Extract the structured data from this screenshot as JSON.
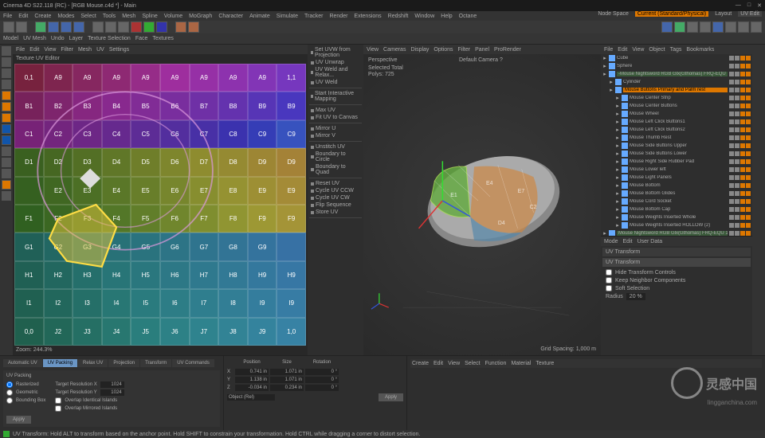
{
  "window": {
    "title": "Cinema 4D S22.118 (RC) - [RGB Mouse.c4d *] - Main",
    "close": "✕",
    "max": "□",
    "min": "—"
  },
  "menu": [
    "File",
    "Edit",
    "Create",
    "Modes",
    "Select",
    "Tools",
    "Mesh",
    "Spline",
    "Volume",
    "MoGraph",
    "Character",
    "Animate",
    "Simulate",
    "Tracker",
    "Render",
    "Extensions",
    "Redshift",
    "Window",
    "Help",
    "Octane"
  ],
  "toolbar2": {
    "modes": [
      "Model",
      "UV Mesh",
      "Undo",
      "Layer",
      "Texture Selection",
      "Face",
      "Textures"
    ]
  },
  "topright": {
    "space": "Node Space",
    "current": "Current (Standard/Physical)",
    "layout": "Layout",
    "uv": "UV Edit"
  },
  "uv": {
    "menu": [
      "File",
      "Edit",
      "View",
      "Filter",
      "Mesh",
      "UV",
      "Settings"
    ],
    "title": "Texture UV Editor",
    "zoom": "Zoom: 244.3%",
    "labels": [
      [
        "0,1",
        "A9",
        "A9",
        "A9",
        "A9",
        "A9",
        "A9",
        "A9",
        "A9",
        "1,1"
      ],
      [
        "B1",
        "B2",
        "B3",
        "B4",
        "B5",
        "B6",
        "B7",
        "B8",
        "B9",
        "B9"
      ],
      [
        "C1",
        "C2",
        "C3",
        "C4",
        "C5",
        "C6",
        "C7",
        "C8",
        "C9",
        "C9"
      ],
      [
        "D1",
        "D2",
        "D3",
        "D4",
        "D5",
        "D6",
        "D7",
        "D8",
        "D9",
        "D9"
      ],
      [
        "",
        "E2",
        "E3",
        "E4",
        "E5",
        "E6",
        "E7",
        "E8",
        "E9",
        "E9"
      ],
      [
        "F1",
        "F2",
        "F3",
        "F4",
        "F5",
        "F6",
        "F7",
        "F8",
        "F9",
        "F9"
      ],
      [
        "G1",
        "G2",
        "G3",
        "G4",
        "G5",
        "G6",
        "G7",
        "G8",
        "G9",
        ""
      ],
      [
        "H1",
        "H2",
        "H3",
        "H4",
        "H5",
        "H6",
        "H7",
        "H8",
        "H9",
        "H9"
      ],
      [
        "I1",
        "I2",
        "I3",
        "I4",
        "I5",
        "I6",
        "I7",
        "I8",
        "I9",
        "I9"
      ],
      [
        "0,0",
        "J2",
        "J3",
        "J4",
        "J5",
        "J6",
        "J7",
        "J8",
        "J9",
        "1,0"
      ]
    ]
  },
  "uvtools": {
    "sections": [
      {
        "title": "",
        "items": [
          "Set UVW from Projection",
          "UV Unwrap",
          "UV Weld and Relax...",
          "UV Weld"
        ]
      },
      {
        "title": "",
        "items": [
          "Start Interactive Mapping"
        ]
      },
      {
        "title": "",
        "items": [
          "Max UV",
          "Fit UV to Canvas"
        ]
      },
      {
        "title": "",
        "items": [
          "Mirror U",
          "Mirror V"
        ]
      },
      {
        "title": "",
        "items": [
          "Unstitch UV",
          "Boundary to Circle",
          "Boundary to Quad"
        ]
      },
      {
        "title": "",
        "items": [
          "Reset UV",
          "Cycle UV CCW",
          "Cycle UV CW",
          "Flip Sequence",
          "Store UV"
        ]
      }
    ]
  },
  "viewport": {
    "menu": [
      "View",
      "Cameras",
      "Display",
      "Options",
      "Filter",
      "Panel",
      "ProRender"
    ],
    "persp": "Perspective",
    "cam": "Default Camera ?",
    "total": "Selected Total",
    "polys": "Polys: 725",
    "grid": "Grid Spacing: 1,000 m"
  },
  "objects": {
    "menu": [
      "File",
      "Edit",
      "View",
      "Object",
      "Tags",
      "Bookmarks"
    ],
    "items": [
      {
        "n": "Cube",
        "d": 0
      },
      {
        "n": "Sphere",
        "d": 0
      },
      {
        "n": "-Mouse Nightsword RGB Glx(Gthomas) FRQ-EQU",
        "d": 0,
        "hl": true
      },
      {
        "n": "Cylinder",
        "d": 1
      },
      {
        "n": "Mouse Buttons Primary and Palm rest",
        "d": 1,
        "sel": true
      },
      {
        "n": "Mouse Center Strip",
        "d": 2
      },
      {
        "n": "Mouse Center Buttons",
        "d": 2
      },
      {
        "n": "Mouse Wheel",
        "d": 2
      },
      {
        "n": "Mouse Left Click Buttons1",
        "d": 2
      },
      {
        "n": "Mouse Left Click Buttons2",
        "d": 2
      },
      {
        "n": "Mouse Thumb Rest",
        "d": 2
      },
      {
        "n": "Mouse Side Buttons Upper",
        "d": 2
      },
      {
        "n": "Mouse Side Buttons Lower",
        "d": 2
      },
      {
        "n": "Mouse Right Side Rubber Pad",
        "d": 2
      },
      {
        "n": "Mouse Lower left",
        "d": 2
      },
      {
        "n": "Mouse Light Panels",
        "d": 2
      },
      {
        "n": "Mouse Bottom",
        "d": 2
      },
      {
        "n": "Mouse Bottom Glides",
        "d": 2
      },
      {
        "n": "Mouse Cord Socket",
        "d": 2
      },
      {
        "n": "Mouse Bottom Cap",
        "d": 2
      },
      {
        "n": "Mouse Weights Inserted Whole",
        "d": 2
      },
      {
        "n": "Mouse Weights Inserted HOLLOW (2)",
        "d": 2
      },
      {
        "n": "Mouse Nightsword RGB Glx(Gthomas) FRQ-EQU 1",
        "d": 0,
        "hl": true
      }
    ]
  },
  "attr": {
    "menu": [
      "Mode",
      "Edit",
      "User Data"
    ],
    "title": "UV Transform",
    "t2": "UV Transform",
    "chk1": "Hide Transform Controls",
    "chk2": "Keep Neighbor Components",
    "chk3": "Soft Selection",
    "radius": "Radius",
    "rval": "20 %"
  },
  "bottom": {
    "tabs": [
      "Automatic UV",
      "UV Packing",
      "Relax UV",
      "Projection",
      "Transform",
      "UV Commands"
    ],
    "pack": {
      "title": "UV Packing",
      "rast": "Rasterized",
      "geo": "Geometric",
      "bb": "Bounding Box",
      "trx": "Target Resolution X",
      "trxv": "1024",
      "try": "Target Resolution Y",
      "tryv": "1024",
      "ovi": "Overlap Identical Islands",
      "ovm": "Overlap Mirrored Islands",
      "apply": "Apply"
    },
    "coord": {
      "hdrs": [
        "Position",
        "Size",
        "Rotation"
      ],
      "x": {
        "l": "X",
        "p": "0.741 in",
        "s": "1.071 in",
        "r": "0 °"
      },
      "y": {
        "l": "Y",
        "p": "1.138 in",
        "s": "1.071 in",
        "r": "0 °"
      },
      "z": {
        "l": "Z",
        "p": "-0.034 in",
        "s": "0.234 in",
        "r": "0 °"
      },
      "obj": "Object (Rel)",
      "apply": "Apply"
    },
    "rmenu": [
      "Create",
      "Edit",
      "View",
      "Select",
      "Function",
      "Material",
      "Texture"
    ]
  },
  "status": "UV Transform: Hold ALT to transform based on the anchor point. Hold SHIFT to constrain your transformation. Hold CTRL while dragging a corner to distort selection.",
  "watermark": {
    "big": "灵感中国",
    "sub": "lingganchina.com"
  }
}
